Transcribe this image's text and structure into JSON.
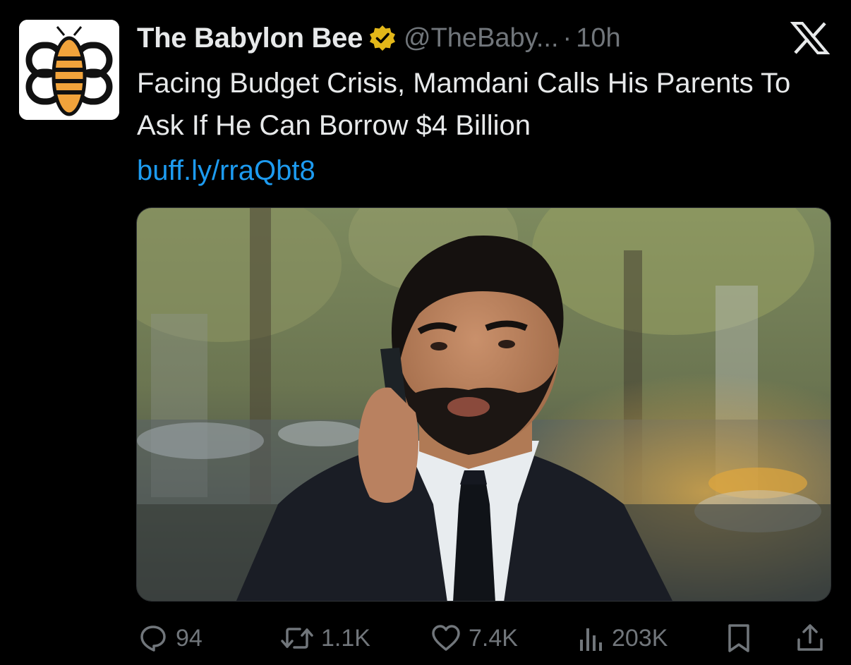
{
  "account": {
    "name": "The Babylon Bee",
    "handle": "@TheBaby...",
    "separator": "·",
    "time": "10h",
    "verified": true,
    "avatar_icon": "bee-logo-icon"
  },
  "tweet": {
    "text": "Facing Budget Crisis, Mamdani Calls His Parents To Ask If He Can Borrow $4 Billion",
    "link": "buff.ly/rraQbt8"
  },
  "media": {
    "icon": "photo-man-on-phone"
  },
  "actions": {
    "replies": "94",
    "retweets": "1.1K",
    "likes": "7.4K",
    "views": "203K"
  },
  "colors": {
    "background": "#000000",
    "text": "#e7e9ea",
    "muted": "#71767b",
    "link": "#1d9bf0",
    "verified_gold": "#e2b719"
  }
}
